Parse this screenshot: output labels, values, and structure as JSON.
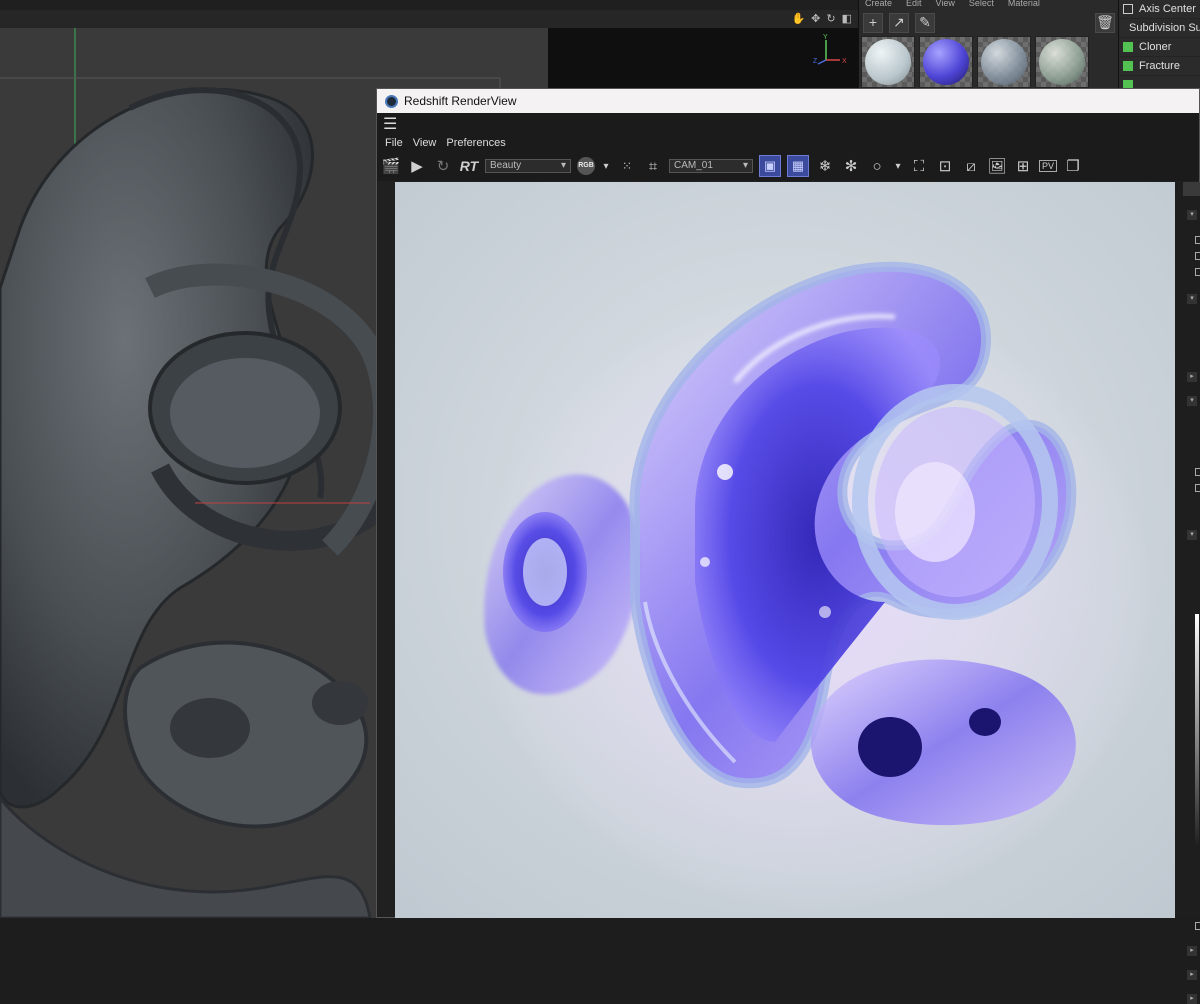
{
  "material_manager": {
    "menu": [
      "Create",
      "Edit",
      "View",
      "Select",
      "Material"
    ],
    "tools": [
      "plus-icon",
      "arrow-icon",
      "picker-icon",
      "trash-icon"
    ],
    "swatches": [
      {
        "name": "white-material",
        "color": "#d3dde0"
      },
      {
        "name": "purple-material",
        "color": "#5046d8"
      },
      {
        "name": "glass-material-1",
        "color": "#8fa0b0"
      },
      {
        "name": "glass-material-2",
        "color": "#9db0a8"
      }
    ]
  },
  "object_list": {
    "items": [
      {
        "label": "Axis Center",
        "icon_color": "#cccccc"
      },
      {
        "label": "Subdivision Su",
        "icon_color": "#53c253"
      },
      {
        "label": "Cloner",
        "icon_color": "#53c253"
      },
      {
        "label": "Fracture",
        "icon_color": "#53c253"
      },
      {
        "label": "",
        "icon_color": "#53c253"
      }
    ]
  },
  "renderview": {
    "title": "Redshift RenderView",
    "menu": [
      "File",
      "View",
      "Preferences"
    ],
    "rt_label": "RT",
    "aov_select": "Beauty",
    "rgb_label": "RGB",
    "camera_select": "CAM_01",
    "pv_label": "PV"
  },
  "colors": {
    "render_background": "#c9d1d8",
    "accent_blue": "#3c4a9e",
    "viewport_bg": "#3a3a3a"
  }
}
